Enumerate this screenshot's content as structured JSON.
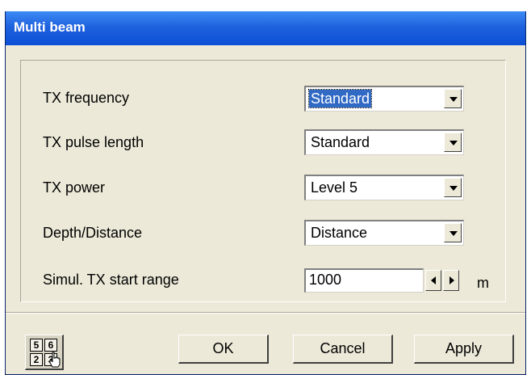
{
  "window": {
    "title": "Multi beam"
  },
  "settings": {
    "tx_frequency": {
      "label": "TX frequency",
      "value": "Standard"
    },
    "tx_pulse_length": {
      "label": "TX pulse length",
      "value": "Standard"
    },
    "tx_power": {
      "label": "TX power",
      "value": "Level 5"
    },
    "depth_distance": {
      "label": "Depth/Distance",
      "value": "Distance"
    },
    "simul_tx_start_range": {
      "label": "Simul. TX start range",
      "value": "1000",
      "unit": "m"
    }
  },
  "keypad": {
    "keys": [
      "5",
      "6",
      "2",
      "3"
    ]
  },
  "buttons": {
    "ok": "OK",
    "cancel": "Cancel",
    "apply": "Apply"
  },
  "colors": {
    "title_bar": "#0b4fd6",
    "selection": "#316ac5",
    "dialog_bg": "#ece9d8"
  }
}
